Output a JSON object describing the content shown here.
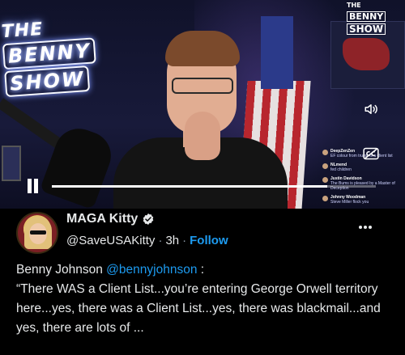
{
  "video": {
    "overlay_logo_lines": [
      "THE",
      "BENNY",
      "SHOW"
    ],
    "corner_badge_lines": [
      "THE",
      "BENNY",
      "SHOW"
    ],
    "progress_fraction": 0.85,
    "chat_messages": [
      {
        "author": "DeepZenZen",
        "text": "EF colour from trump is a client list"
      },
      {
        "author": "NLmend",
        "text": "fed children"
      },
      {
        "author": "Justin Davidson",
        "text": "The Bums is pleased by a Master of Deception"
      },
      {
        "author": "Johnny Woodman",
        "text": "Steve Miller flock you"
      }
    ],
    "icons": {
      "sound": "speaker-icon",
      "captions": "closed-captions-icon",
      "pause": "pause-icon"
    }
  },
  "tweet": {
    "display_name": "MAGA Kitty",
    "handle": "@SaveUSAKitty",
    "separator": "·",
    "time": "3h",
    "follow_label": "Follow",
    "accent_color": "#1d9bf0",
    "author": "Benny Johnson",
    "mention": "@bennyjohnson",
    "after_mention": " :",
    "body": "“There WAS a Client List...you’re entering George Orwell territory here...yes, there was a Client List...yes, there was blackmail...and yes, there are lots of ..."
  }
}
